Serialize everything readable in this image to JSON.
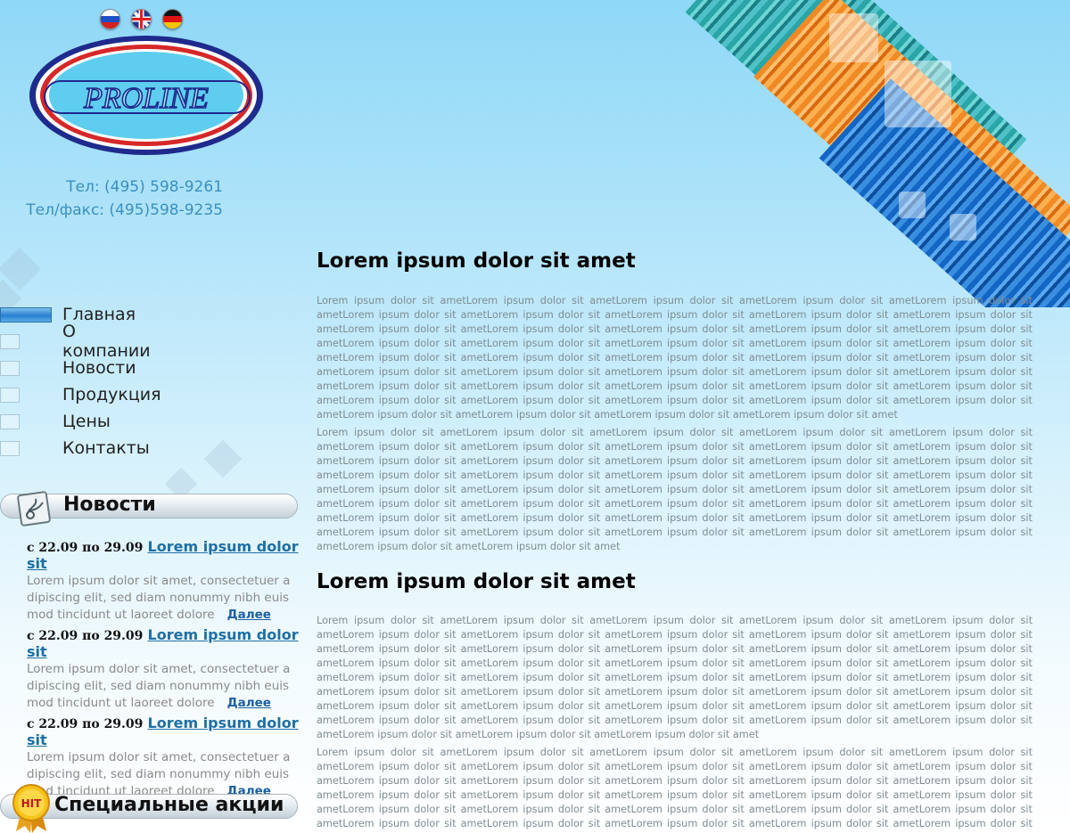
{
  "languages": [
    "ru-flag-icon",
    "uk-flag-icon",
    "de-flag-icon"
  ],
  "logo": {
    "text": "PROLINE"
  },
  "contacts": {
    "phone": "Тел: (495) 598-9261",
    "fax": "Тел/факс: (495)598-9235"
  },
  "nav": {
    "items": [
      {
        "label": "Главная",
        "active": true
      },
      {
        "label": "О компании"
      },
      {
        "label": "Новости"
      },
      {
        "label": "Продукция"
      },
      {
        "label": "Цены"
      },
      {
        "label": "Контакты"
      }
    ]
  },
  "news_section": {
    "title": "Новости",
    "items": [
      {
        "date": "с 22.09 по 29.09",
        "link": "Lorem ipsum dolor sit",
        "text": "Lorem ipsum dolor sit amet, consectetuer a dipiscing elit, sed diam nonummy nibh euis mod tincidunt ut laoreet dolore",
        "more": "Далее"
      },
      {
        "date": "с 22.09 по 29.09",
        "link": "Lorem ipsum dolor sit",
        "text": "Lorem ipsum dolor sit amet, consectetuer a dipiscing elit, sed diam nonummy nibh euis mod tincidunt ut laoreet dolore",
        "more": "Далее"
      },
      {
        "date": "с 22.09 по 29.09",
        "link": "Lorem ipsum dolor sit",
        "text": "Lorem ipsum dolor sit amet, consectetuer a dipiscing elit, sed diam nonummy nibh euis mod tincidunt ut laoreet dolore",
        "more": "Далее"
      }
    ]
  },
  "special_section": {
    "title": "Специальные акции",
    "badge": "HIT"
  },
  "main": {
    "heading1": "Lorem ipsum dolor sit amet",
    "heading2": "Lorem ipsum dolor sit amet",
    "p1": "Lorem ipsum dolor sit ametLorem ipsum dolor sit ametLorem ipsum dolor sit ametLorem ipsum dolor sit ametLorem ipsum dolor sit ametLorem ipsum dolor sit ametLorem ipsum dolor sit ametLorem ipsum dolor sit ametLorem ipsum dolor sit ametLorem ipsum dolor sit ametLorem ipsum dolor sit ametLorem ipsum dolor sit ametLorem ipsum dolor sit ametLorem ipsum dolor sit ametLorem ipsum dolor sit ametLorem ipsum dolor sit ametLorem ipsum dolor sit ametLorem ipsum dolor sit ametLorem ipsum dolor sit ametLorem ipsum dolor sit ametLorem ipsum dolor sit ametLorem ipsum dolor sit ametLorem ipsum dolor sit ametLorem ipsum dolor sit ametLorem ipsum dolor sit ametLorem ipsum dolor sit ametLorem ipsum dolor sit ametLorem ipsum dolor sit ametLorem ipsum dolor sit ametLorem ipsum dolor sit ametLorem ipsum dolor sit ametLorem ipsum dolor sit ametLorem ipsum dolor sit ametLorem ipsum dolor sit ametLorem ipsum dolor sit ametLorem ipsum dolor sit ametLorem ipsum dolor sit ametLorem ipsum dolor sit ametLorem ipsum dolor sit ametLorem ipsum dolor sit ametLorem ipsum dolor sit ametLorem ipsum dolor sit ametLorem ipsum dolor sit ametLorem ipsum dolor sit amet",
    "p2": "Lorem ipsum dolor sit ametLorem ipsum dolor sit ametLorem ipsum dolor sit ametLorem ipsum dolor sit ametLorem ipsum dolor sit ametLorem ipsum dolor sit ametLorem ipsum dolor sit ametLorem ipsum dolor sit ametLorem ipsum dolor sit ametLorem ipsum dolor sit ametLorem ipsum dolor sit ametLorem ipsum dolor sit ametLorem ipsum dolor sit ametLorem ipsum dolor sit ametLorem ipsum dolor sit ametLorem ipsum dolor sit ametLorem ipsum dolor sit ametLorem ipsum dolor sit ametLorem ipsum dolor sit ametLorem ipsum dolor sit ametLorem ipsum dolor sit ametLorem ipsum dolor sit ametLorem ipsum dolor sit ametLorem ipsum dolor sit ametLorem ipsum dolor sit ametLorem ipsum dolor sit ametLorem ipsum dolor sit ametLorem ipsum dolor sit ametLorem ipsum dolor sit ametLorem ipsum dolor sit ametLorem ipsum dolor sit ametLorem ipsum dolor sit ametLorem ipsum dolor sit ametLorem ipsum dolor sit ametLorem ipsum dolor sit ametLorem ipsum dolor sit ametLorem ipsum dolor sit ametLorem ipsum dolor sit ametLorem ipsum dolor sit ametLorem ipsum dolor sit ametLorem ipsum dolor sit ametLorem ipsum dolor sit amet",
    "p3": "Lorem ipsum dolor sit ametLorem ipsum dolor sit ametLorem ipsum dolor sit ametLorem ipsum dolor sit ametLorem ipsum dolor sit ametLorem ipsum dolor sit ametLorem ipsum dolor sit ametLorem ipsum dolor sit ametLorem ipsum dolor sit ametLorem ipsum dolor sit ametLorem ipsum dolor sit ametLorem ipsum dolor sit ametLorem ipsum dolor sit ametLorem ipsum dolor sit ametLorem ipsum dolor sit ametLorem ipsum dolor sit ametLorem ipsum dolor sit ametLorem ipsum dolor sit ametLorem ipsum dolor sit ametLorem ipsum dolor sit ametLorem ipsum dolor sit ametLorem ipsum dolor sit ametLorem ipsum dolor sit ametLorem ipsum dolor sit ametLorem ipsum dolor sit ametLorem ipsum dolor sit ametLorem ipsum dolor sit ametLorem ipsum dolor sit ametLorem ipsum dolor sit ametLorem ipsum dolor sit ametLorem ipsum dolor sit ametLorem ipsum dolor sit ametLorem ipsum dolor sit ametLorem ipsum dolor sit ametLorem ipsum dolor sit ametLorem ipsum dolor sit ametLorem ipsum dolor sit ametLorem ipsum dolor sit ametLorem ipsum dolor sit ametLorem ipsum dolor sit ametLorem ipsum dolor sit ametLorem ipsum dolor sit ametLorem ipsum dolor sit amet",
    "p4": "Lorem ipsum dolor sit ametLorem ipsum dolor sit ametLorem ipsum dolor sit ametLorem ipsum dolor sit ametLorem ipsum dolor sit ametLorem ipsum dolor sit ametLorem ipsum dolor sit ametLorem ipsum dolor sit ametLorem ipsum dolor sit ametLorem ipsum dolor sit ametLorem ipsum dolor sit ametLorem ipsum dolor sit ametLorem ipsum dolor sit ametLorem ipsum dolor sit ametLorem ipsum dolor sit ametLorem ipsum dolor sit ametLorem ipsum dolor sit ametLorem ipsum dolor sit ametLorem ipsum dolor sit ametLorem ipsum dolor sit ametLorem ipsum dolor sit ametLorem ipsum dolor sit ametLorem ipsum dolor sit ametLorem ipsum dolor sit ametLorem ipsum dolor sit ametLorem ipsum dolor sit ametLorem ipsum dolor sit ametLorem ipsum dolor sit ametLorem ipsum dolor sit ametLorem ipsum dolor sit ametLorem ipsum dolor sit ametLorem ipsum dolor sit ametLorem ipsum dolor sit ametLorem ipsum dolor sit ametLorem ipsum dolor sit ametLorem ipsum dolor sit ametLorem ipsum dolor sit ametLorem ipsum dolor sit amet"
  }
}
